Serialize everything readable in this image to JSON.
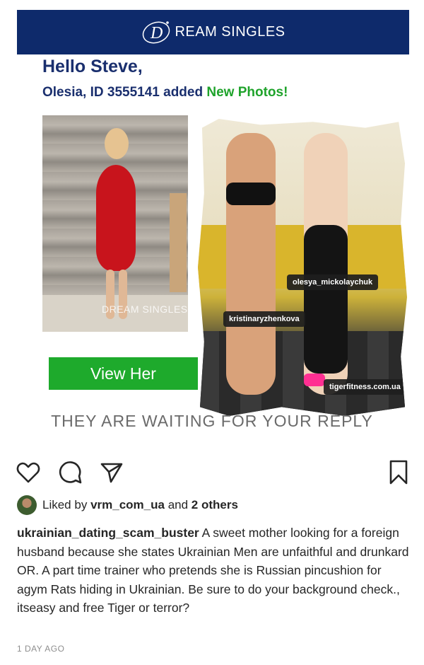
{
  "email": {
    "brand_name": "REAM SINGLES",
    "greeting": "Hello Steve,",
    "member_name": "Olesia, ID 3555141",
    "added_text": "added",
    "new_photos": "New Photos!",
    "button_label": "View Her",
    "waiting_text": "THEY ARE WAITING FOR YOUR REPLY",
    "photo_watermark": "DREAM SINGLES"
  },
  "overlay": {
    "tags": [
      "olesya_mickolaychuk",
      "kristinaryzhenkova",
      "tigerfitness.com.ua"
    ]
  },
  "post": {
    "liked_by_prefix": "Liked by",
    "liked_by_user": "vrm_com_ua",
    "liked_by_and": "and",
    "liked_by_others": "2 others",
    "author": "ukrainian_dating_scam_buster",
    "caption": "A sweet mother looking for a foreign husband because she states Ukrainian Men are unfaithful and drunkard OR. A part time trainer who pretends she is Russian pincushion for agym Rats hiding in Ukrainian. Be sure to do your background check., itseasy and free Tiger or terror?",
    "timestamp": "1 DAY AGO"
  },
  "colors": {
    "brand_navy": "#0e2a6b",
    "heading_navy": "#1a2f6e",
    "green": "#1fa32b",
    "text": "#262626",
    "muted": "#8e8e8e"
  },
  "icons": [
    "heart-icon",
    "comment-icon",
    "share-icon",
    "bookmark-icon"
  ]
}
